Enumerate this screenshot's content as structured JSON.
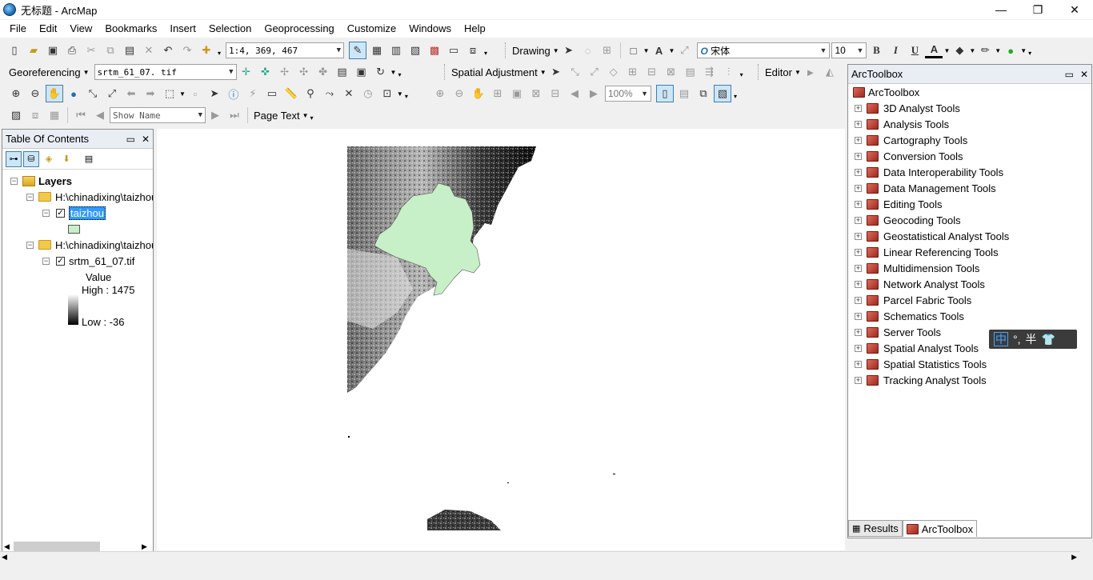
{
  "window": {
    "title": "无标题 - ArcMap",
    "minimize": "—",
    "restore": "❐",
    "close": "✕"
  },
  "menu": [
    "File",
    "Edit",
    "View",
    "Bookmarks",
    "Insert",
    "Selection",
    "Geoprocessing",
    "Customize",
    "Windows",
    "Help"
  ],
  "toolbar1": {
    "scale_value": "1:4, 369, 467",
    "drawing_label": "Drawing",
    "font_name": "宋体",
    "font_size": "10",
    "bold": "B",
    "italic": "I",
    "underline": "U",
    "font_color": "A"
  },
  "toolbar2": {
    "georef_label": "Georeferencing",
    "georef_layer": "srtm_61_07. tif",
    "spatial_adjustment_label": "Spatial Adjustment",
    "editor_label": "Editor"
  },
  "toolbar3": {
    "zoom_value": "100%"
  },
  "toolbar4": {
    "show_name": "Show Name",
    "page_text_label": "Page Text"
  },
  "toc": {
    "title": "Table Of Contents",
    "layers_label": "Layers",
    "group1_path": "H:\\chinadixing\\taizhou",
    "layer1_name": "taizhou",
    "group2_path": "H:\\chinadixing\\taizhou",
    "layer2_name": "srtm_61_07.tif",
    "legend_value": "Value",
    "legend_high": "High : 1475",
    "legend_low": "Low : -36",
    "polygon_color": "#c8f0c8"
  },
  "arctoolbox": {
    "title": "ArcToolbox",
    "root": "ArcToolbox",
    "tools": [
      "3D Analyst Tools",
      "Analysis Tools",
      "Cartography Tools",
      "Conversion Tools",
      "Data Interoperability Tools",
      "Data Management Tools",
      "Editing Tools",
      "Geocoding Tools",
      "Geostatistical Analyst Tools",
      "Linear Referencing Tools",
      "Multidimension Tools",
      "Network Analyst Tools",
      "Parcel Fabric Tools",
      "Schematics Tools",
      "Server Tools",
      "Spatial Analyst Tools",
      "Spatial Statistics Tools",
      "Tracking Analyst Tools"
    ]
  },
  "bottom_tabs": {
    "results": "Results",
    "arctoolbox": "ArcToolbox"
  },
  "ime": {
    "mode": "中",
    "punct": "°,",
    "width": "半"
  },
  "colors": {
    "selection": "#3399ff",
    "dock_header": "#e9eef4"
  }
}
